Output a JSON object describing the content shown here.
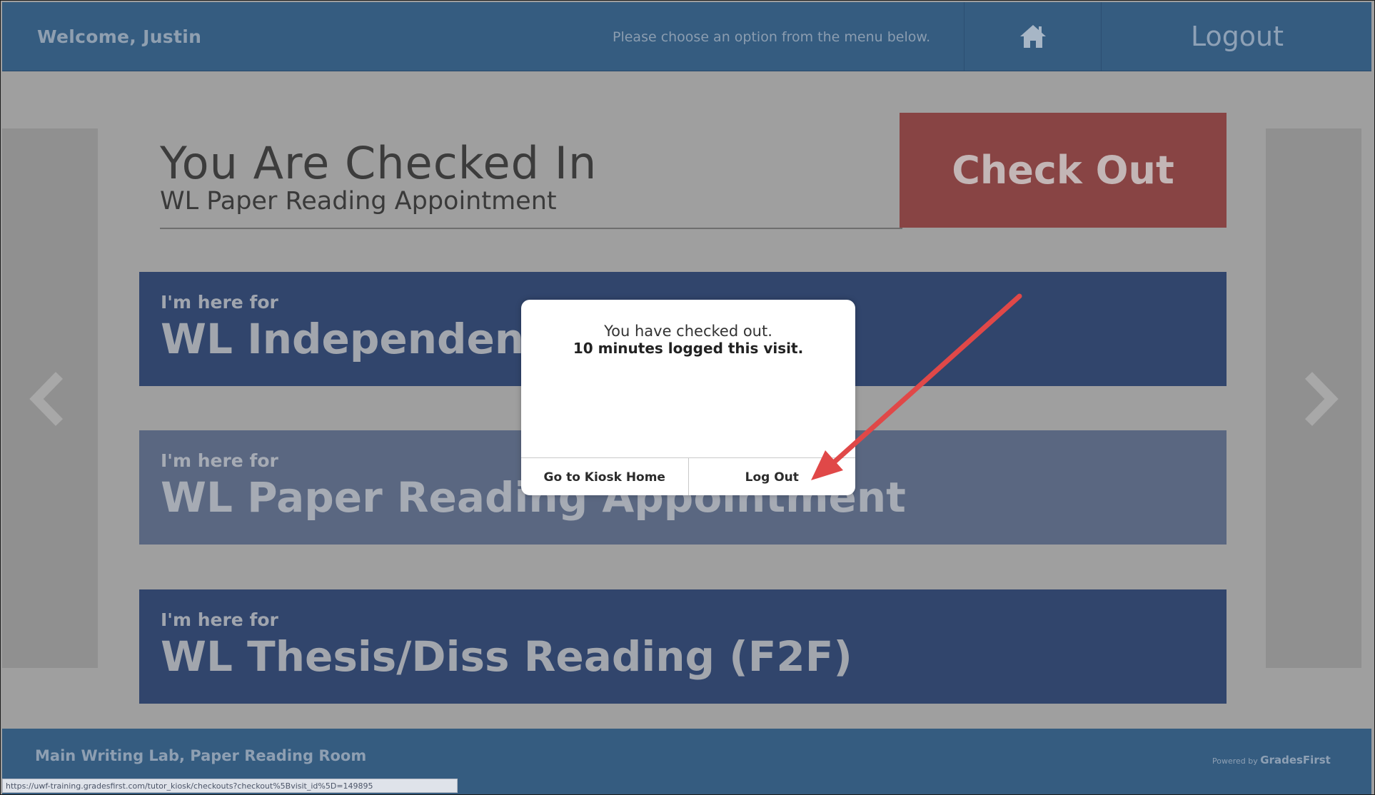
{
  "header": {
    "welcome": "Welcome, Justin",
    "hint": "Please choose an option from the menu below.",
    "home_icon": "home-icon",
    "logout_label": "Logout"
  },
  "status": {
    "title": "You Are Checked In",
    "subtitle": "WL Paper Reading Appointment",
    "checkout_label": "Check Out"
  },
  "options": [
    {
      "prefix": "I'm here for",
      "name": "WL Independent"
    },
    {
      "prefix": "I'm here for",
      "name": "WL Paper Reading Appointment"
    },
    {
      "prefix": "I'm here for",
      "name": "WL Thesis/Diss Reading (F2F)"
    }
  ],
  "modal": {
    "message": "You have checked out.",
    "minutes": "10 minutes logged this visit.",
    "kiosk_home_label": "Go to Kiosk Home",
    "logout_label": "Log Out"
  },
  "footer": {
    "location": "Main Writing Lab, Paper Reading Room",
    "powered_prefix": "Powered by",
    "powered_brand": "GradesFirst",
    "status_url": "https://uwf-training.gradesfirst.com/tutor_kiosk/checkouts?checkout%5Bvisit_id%5D=149895"
  },
  "colors": {
    "header_bg": "#355c80",
    "checkout_bg": "#884444",
    "card_bg": "#31456c",
    "card_selected_bg": "#5a6781",
    "annotation_arrow": "#e04848"
  }
}
